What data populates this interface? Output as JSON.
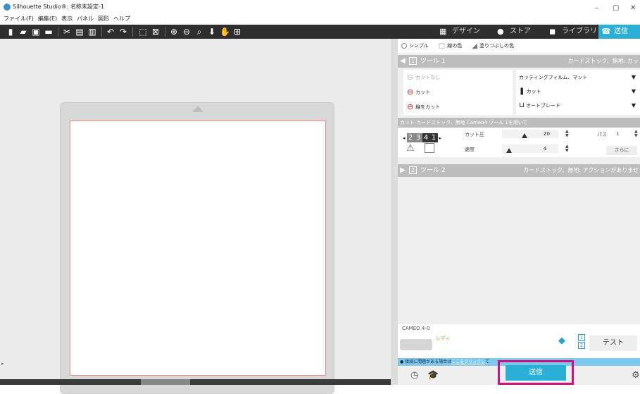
{
  "window": {
    "title": "Silhouette Studio®: 名称未設定-1",
    "menu": [
      "ファイル(F)",
      "編集(E)",
      "表示",
      "パネル",
      "図形",
      "ヘルプ"
    ]
  },
  "toolbar": {
    "icons": [
      "new-file-icon",
      "open-icon",
      "save-icon",
      "print-icon",
      "cut-icon",
      "copy-icon",
      "paste-icon",
      "undo-icon",
      "redo-icon",
      "select-all-icon",
      "deselect-icon",
      "zoom-in-icon",
      "zoom-out-icon",
      "zoom-fit-icon",
      "pan-down-icon",
      "pan-hand-icon",
      "fit-page-icon"
    ],
    "tabs": [
      {
        "label": "デザイン",
        "icon": "grid-icon"
      },
      {
        "label": "ストア",
        "icon": "store-icon"
      },
      {
        "label": "ライブラリ",
        "icon": "library-icon"
      },
      {
        "label": "送信",
        "icon": "send-icon",
        "active": true
      }
    ]
  },
  "panel": {
    "modes": [
      "シンプル",
      "線の色",
      "塗りつぶしの色"
    ],
    "tool1": {
      "number": "1",
      "label": "ツール 1",
      "right": "カードストック、無地: カッ",
      "actions": [
        "カットなし",
        "カット",
        "線をカット"
      ],
      "material": "カッティングフィルム、マット",
      "action": "カット",
      "blade": "オートブレード"
    },
    "cut_summary": "カット カードストック、無地 Cameo4 ツール 1を用いて",
    "settings": {
      "steps": [
        "2",
        "3",
        "4",
        "1"
      ],
      "force_label": "カット圧",
      "force_value": "20",
      "passes_label": "パス",
      "passes_value": "1",
      "speed_label": "速度",
      "speed_value": "4",
      "more_label": "さらに",
      "force_level": 0.5,
      "speed_level": 0.1
    },
    "tool2": {
      "number": "2",
      "label": "ツール 2",
      "right": "カードストック、無地: アクションがありませ"
    },
    "device": {
      "name": "CAMEO 4-0",
      "status": "レディ",
      "pages": [
        "1",
        "2"
      ],
      "test_label": "テスト"
    },
    "help": {
      "text_before": "接続に問題がある場合は",
      "link": "ここをクリックし",
      "text_after": "て"
    },
    "send_label": "送信"
  },
  "colors": {
    "accent": "#2ab0d6",
    "highlight": "#d2127a",
    "ready": "#6abf2c"
  }
}
